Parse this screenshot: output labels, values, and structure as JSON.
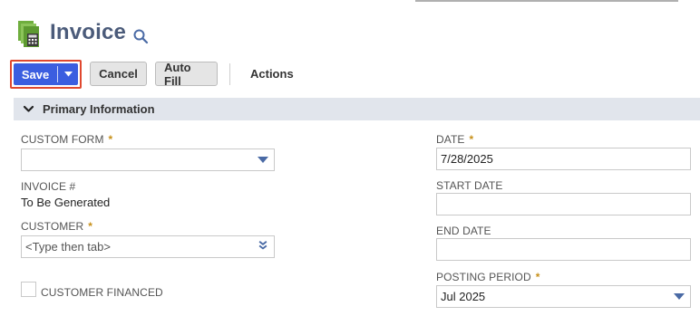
{
  "header": {
    "title": "Invoice",
    "record_icon": "invoice-document-icon",
    "search_icon": "search-icon"
  },
  "toolbar": {
    "save_label": "Save",
    "save_menu_icon": "caret-down-icon",
    "cancel_label": "Cancel",
    "autofill_label": "Auto Fill",
    "actions_label": "Actions"
  },
  "section": {
    "title": "Primary Information",
    "collapse_icon": "chevron-down-icon"
  },
  "fields": {
    "custom_form": {
      "label": "CUSTOM FORM",
      "required": "*",
      "value": ""
    },
    "invoice_number": {
      "label": "INVOICE #",
      "value": "To Be Generated"
    },
    "customer": {
      "label": "CUSTOMER",
      "required": "*",
      "placeholder": "<Type then tab>"
    },
    "customer_financed": {
      "label": "CUSTOMER FINANCED",
      "checked": false
    },
    "date": {
      "label": "DATE",
      "required": "*",
      "value": "7/28/2025"
    },
    "start_date": {
      "label": "START DATE",
      "value": ""
    },
    "end_date": {
      "label": "END DATE",
      "value": ""
    },
    "posting_period": {
      "label": "POSTING PERIOD",
      "required": "*",
      "value": "Jul 2025"
    }
  },
  "colors": {
    "primary_button": "#3b5ee0",
    "focus_outline": "#e0482f",
    "title_text": "#4b5b7a",
    "required_marker": "#c7901a",
    "section_background": "#e1e5ec",
    "icon_accent": "#4a6aa5"
  }
}
